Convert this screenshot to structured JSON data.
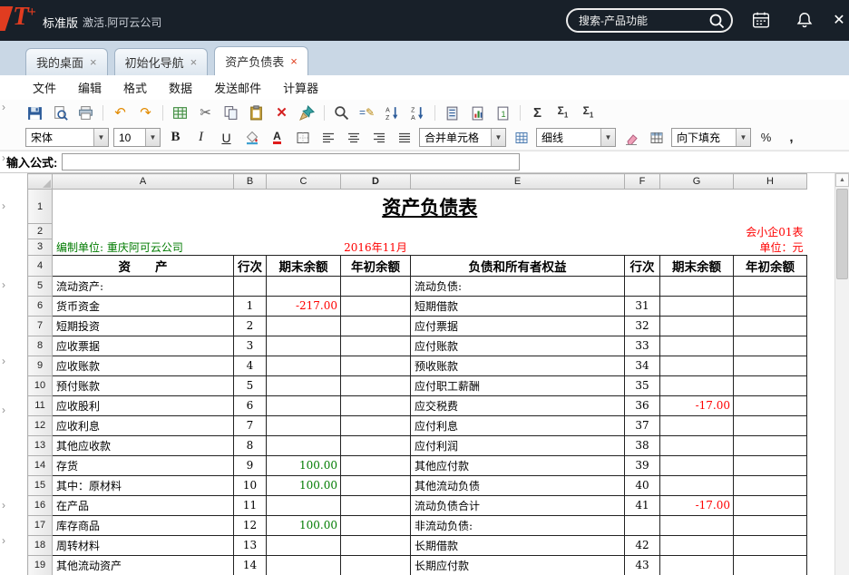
{
  "topbar": {
    "edition": "标准版",
    "activation": "激活.阿可云公司",
    "search": {
      "placeholder": "搜索-产品功能"
    }
  },
  "tabs": [
    {
      "label": "我的桌面",
      "active": false
    },
    {
      "label": "初始化导航",
      "active": false
    },
    {
      "label": "资产负债表",
      "active": true
    }
  ],
  "menu": [
    "文件",
    "编辑",
    "格式",
    "数据",
    "发送邮件",
    "计算器"
  ],
  "toolbar": {
    "icons": [
      "save",
      "print-preview",
      "print",
      "|",
      "undo",
      "redo",
      "|",
      "export-grid",
      "cut",
      "copy",
      "paste",
      "delete",
      "format-painter",
      "|",
      "find",
      "edit-formula",
      "sort-ascending",
      "sort-descending",
      "|",
      "paste-format",
      "paste-chart",
      "paste-value",
      "|",
      "sum",
      "subtotal-1",
      "subtotal-2"
    ]
  },
  "format_bar": {
    "font_name": "宋体",
    "font_size": "10",
    "bold": "B",
    "italic": "I",
    "underline": "U",
    "merge_cells": "合并单元格",
    "line_style": "细线",
    "fill_direction": "向下填充",
    "percent": "%",
    "comma": ","
  },
  "formula_bar": {
    "label": "输入公式:",
    "value": ""
  },
  "icons": {
    "side_chevron": "›",
    "dropdown_arrow": "▼",
    "scroll_up": "▲",
    "tab_close": "×"
  },
  "sheet": {
    "columns": [
      "A",
      "B",
      "C",
      "D",
      "E",
      "F",
      "G",
      "H"
    ],
    "active_column": "D",
    "title": "资产负债表",
    "form_code": "会小企01表",
    "prepared_by": "编制单位: 重庆阿可云公司",
    "period": "2016年11月",
    "unit_label": "单位：元",
    "table_header": {
      "asset": "资　　产",
      "line_no": "行次",
      "ending": "期末余额",
      "beginning": "年初余额",
      "liability": "负债和所有者权益"
    },
    "body": [
      {
        "asset": "流动资产:",
        "a_line": "",
        "a_end": "",
        "a_beg": "",
        "liability": "流动负债:",
        "l_line": "",
        "l_end": "",
        "l_beg": ""
      },
      {
        "asset": "货币资金",
        "a_line": "1",
        "a_end": "-217.00",
        "a_beg": "",
        "liability": "短期借款",
        "l_line": "31",
        "l_end": "",
        "l_beg": ""
      },
      {
        "asset": "短期投资",
        "a_line": "2",
        "a_end": "",
        "a_beg": "",
        "liability": "应付票据",
        "l_line": "32",
        "l_end": "",
        "l_beg": ""
      },
      {
        "asset": "应收票据",
        "a_line": "3",
        "a_end": "",
        "a_beg": "",
        "liability": "应付账款",
        "l_line": "33",
        "l_end": "",
        "l_beg": ""
      },
      {
        "asset": "应收账款",
        "a_line": "4",
        "a_end": "",
        "a_beg": "",
        "liability": "预收账款",
        "l_line": "34",
        "l_end": "",
        "l_beg": ""
      },
      {
        "asset": "预付账款",
        "a_line": "5",
        "a_end": "",
        "a_beg": "",
        "liability": "应付职工薪酬",
        "l_line": "35",
        "l_end": "",
        "l_beg": ""
      },
      {
        "asset": "应收股利",
        "a_line": "6",
        "a_end": "",
        "a_beg": "",
        "liability": "应交税费",
        "l_line": "36",
        "l_end": "-17.00",
        "l_beg": ""
      },
      {
        "asset": "应收利息",
        "a_line": "7",
        "a_end": "",
        "a_beg": "",
        "liability": "应付利息",
        "l_line": "37",
        "l_end": "",
        "l_beg": ""
      },
      {
        "asset": "其他应收款",
        "a_line": "8",
        "a_end": "",
        "a_beg": "",
        "liability": "应付利润",
        "l_line": "38",
        "l_end": "",
        "l_beg": ""
      },
      {
        "asset": "存货",
        "a_line": "9",
        "a_end": "100.00",
        "a_beg": "",
        "liability": "其他应付款",
        "l_line": "39",
        "l_end": "",
        "l_beg": ""
      },
      {
        "asset": "其中：原材料",
        "a_line": "10",
        "a_end": "100.00",
        "a_beg": "",
        "liability": "其他流动负债",
        "l_line": "40",
        "l_end": "",
        "l_beg": ""
      },
      {
        "asset": "在产品",
        "a_line": "11",
        "a_end": "",
        "a_beg": "",
        "liability": "流动负债合计",
        "l_line": "41",
        "l_end": "-17.00",
        "l_beg": ""
      },
      {
        "asset": "库存商品",
        "a_line": "12",
        "a_end": "100.00",
        "a_beg": "",
        "liability": "非流动负债:",
        "l_line": "",
        "l_end": "",
        "l_beg": ""
      },
      {
        "asset": "周转材料",
        "a_line": "13",
        "a_end": "",
        "a_beg": "",
        "liability": "长期借款",
        "l_line": "42",
        "l_end": "",
        "l_beg": ""
      },
      {
        "asset": "其他流动资产",
        "a_line": "14",
        "a_end": "",
        "a_beg": "",
        "liability": "长期应付款",
        "l_line": "43",
        "l_end": "",
        "l_beg": ""
      }
    ],
    "colors": {
      "positive_value": "#007b00",
      "negative_value": "#fe0000",
      "prepared_by": "#007b00",
      "period": "#fe0000",
      "form_code": "#fe0000",
      "unit": "#fe0000"
    }
  }
}
